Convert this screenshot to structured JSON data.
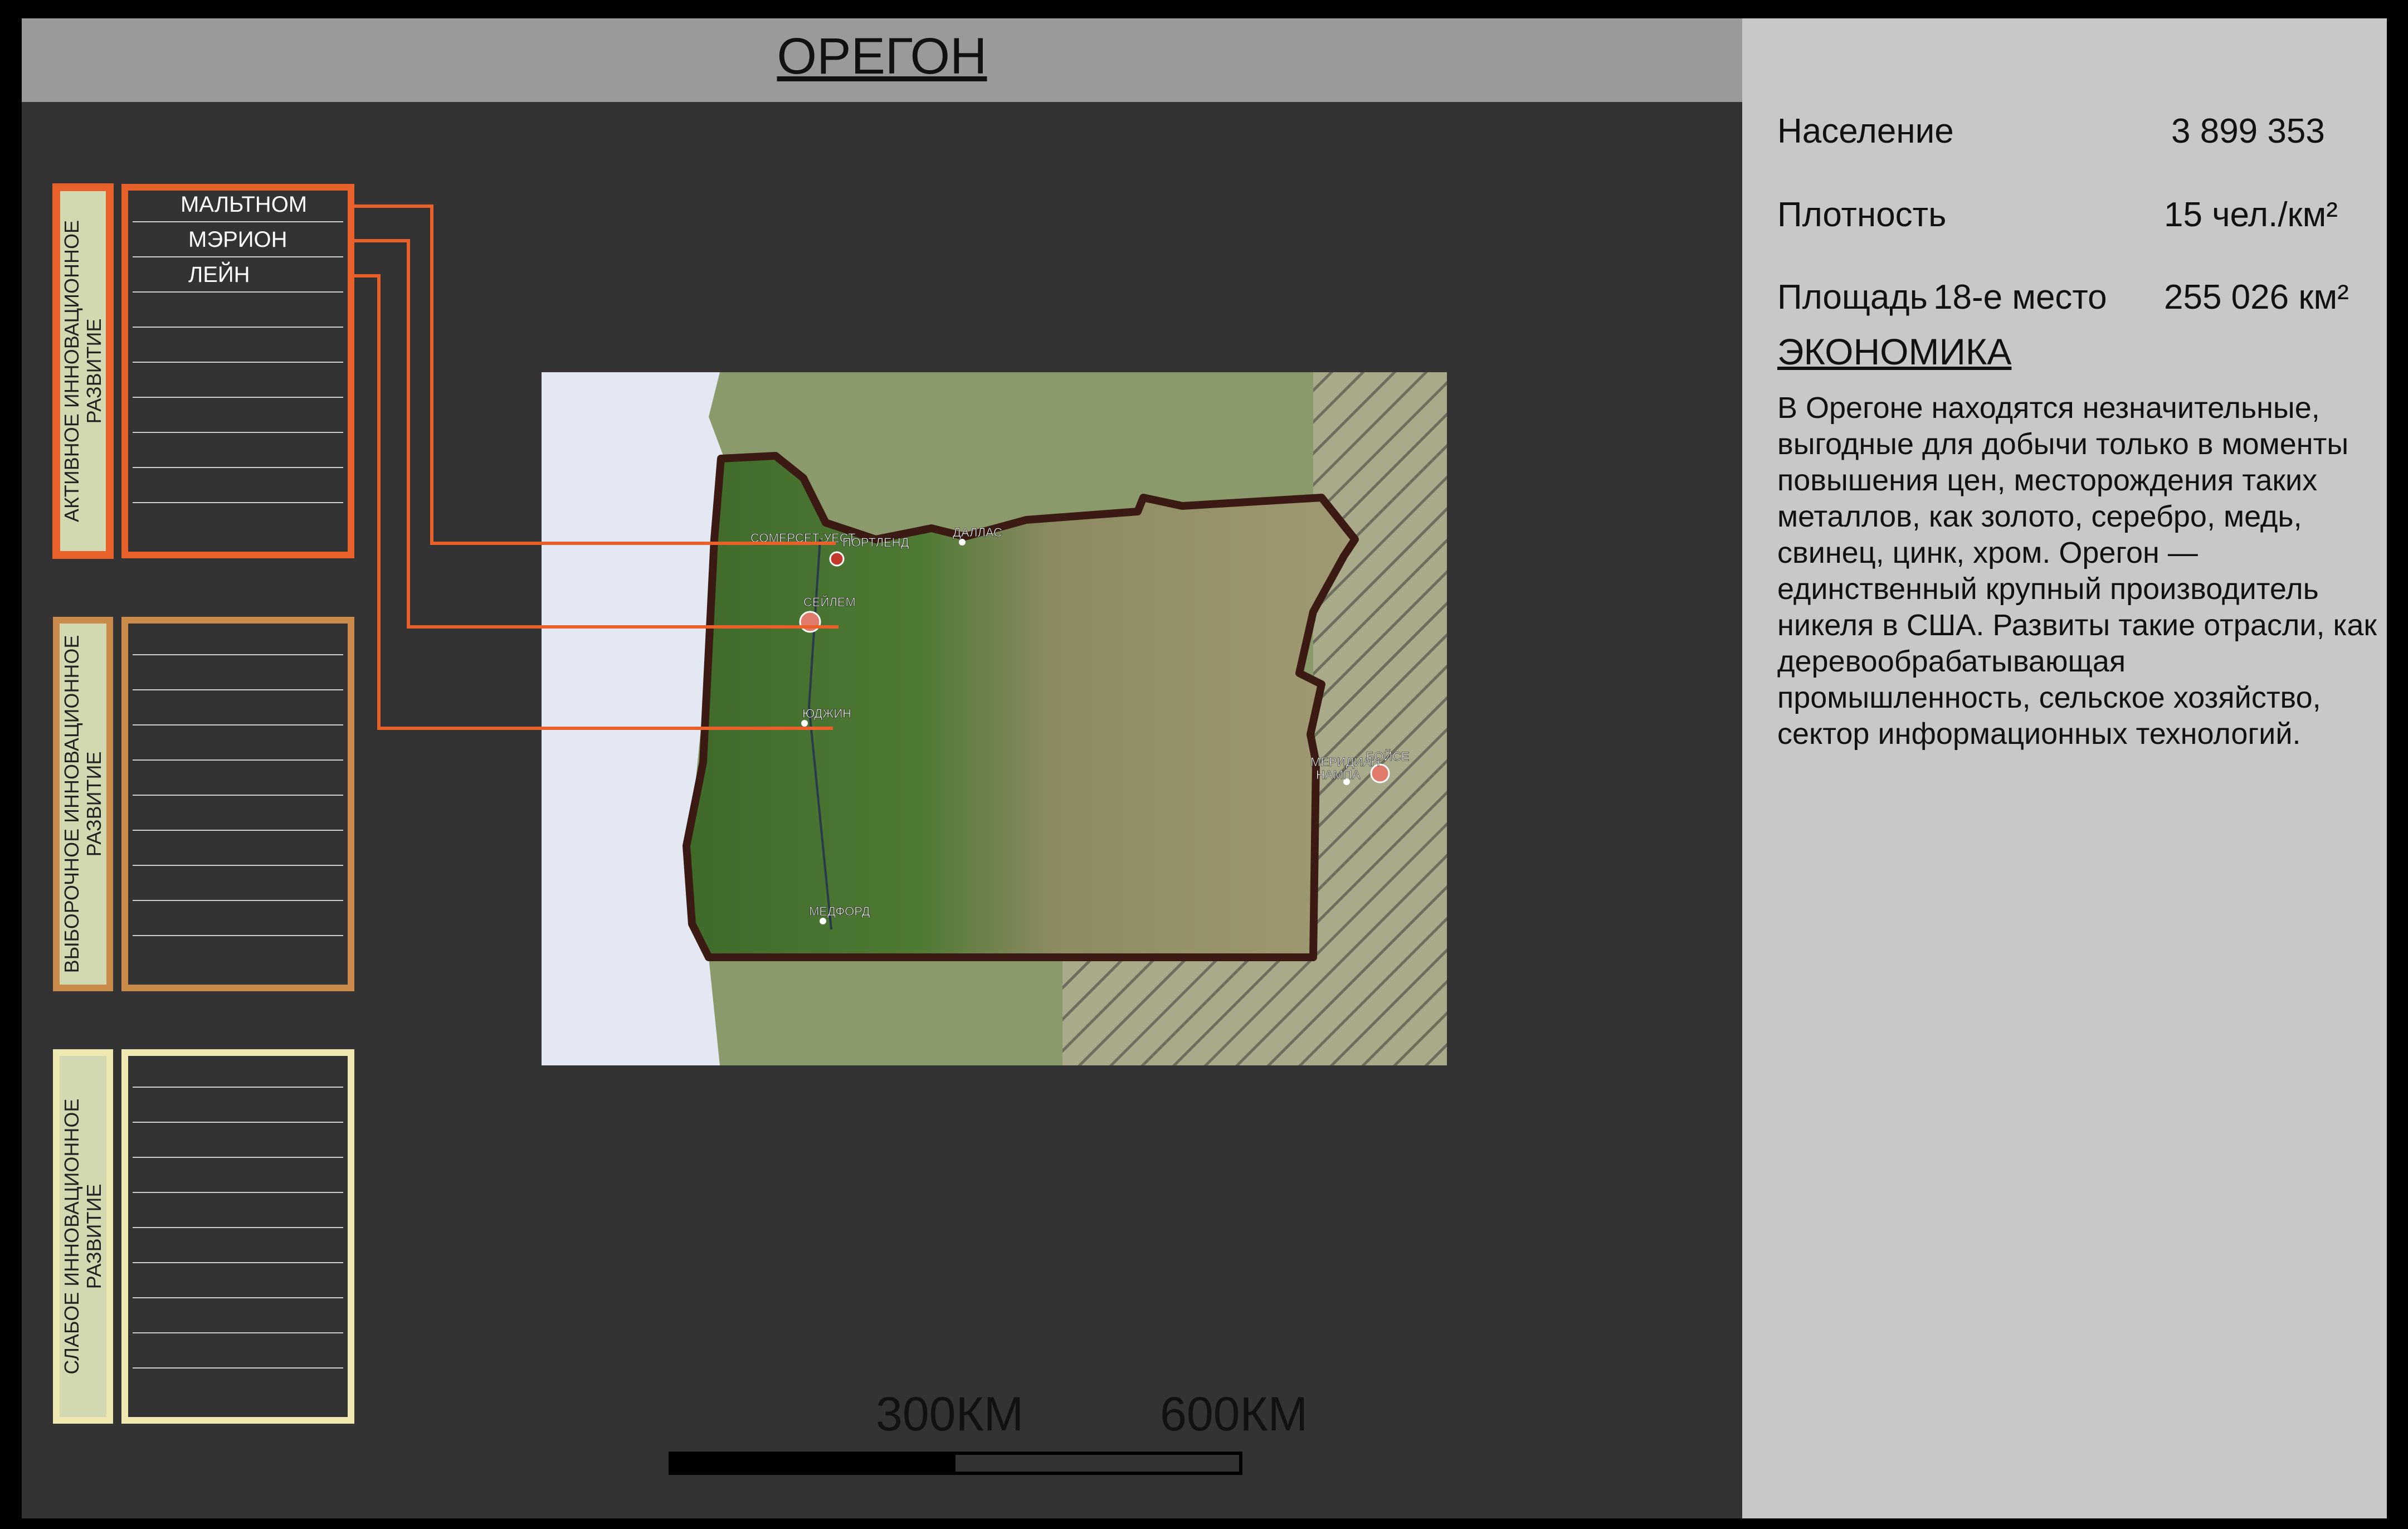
{
  "title": "ОРЕГОН",
  "stats": {
    "population": {
      "label": "Население",
      "value": "3 899 353"
    },
    "density": {
      "label": "Плотность",
      "value": "15 чел./км²"
    },
    "area": {
      "label": "Площадь",
      "rank": "18-е место",
      "value": "255 026 км²"
    }
  },
  "economy": {
    "heading": "ЭКОНОМИКА",
    "text": "В Орегоне находятся незначительные, выгодные для добычи только в моменты повышения цен, месторождения таких металлов, как золото, серебро, медь, свинец, цинк, хром. Орегон — единственный крупный производитель никеля в США. Развиты такие отрасли, как деревообрабатывающая промышленность, сельское хозяйство, сектор информационных технологий."
  },
  "categories": [
    {
      "label": "АКТИВНОЕ ИННОВАЦИОННОЕ РАЗВИТИЕ",
      "color": "#e8602a",
      "items": [
        "МАЛЬТНОМ",
        "МЭРИОН",
        "ЛЕЙН",
        "",
        "",
        "",
        "",
        "",
        "",
        ""
      ]
    },
    {
      "label": "ВЫБОРОЧНОЕ ИННОВАЦИОННОЕ РАЗВИТИЕ",
      "color": "#c98a4a",
      "items": [
        "",
        "",
        "",
        "",
        "",
        "",
        "",
        "",
        "",
        ""
      ]
    },
    {
      "label": "СЛАБОЕ ИННОВАЦИОННОЕ РАЗВИТИЕ",
      "color": "#efe8b0",
      "items": [
        "",
        "",
        "",
        "",
        "",
        "",
        "",
        "",
        "",
        ""
      ]
    }
  ],
  "map": {
    "cities": [
      "СОМЕРСЕТ-УЕСТ",
      "ПОРТЛЕНД",
      "ДАЛЛАС",
      "СЕЙЛЕМ",
      "ЮДЖИН",
      "МЕДФОРД",
      "МЕРИДИАН",
      "БОЙСЕ",
      "НАМПА"
    ],
    "colors": {
      "border": "#3a1a12",
      "leader": "#e8602a",
      "forest": "#3f6a2a",
      "dry": "#8d8a62",
      "ocean": "#e4e8f2"
    }
  },
  "scale": {
    "mark1": "300КМ",
    "mark2": "600КМ"
  }
}
